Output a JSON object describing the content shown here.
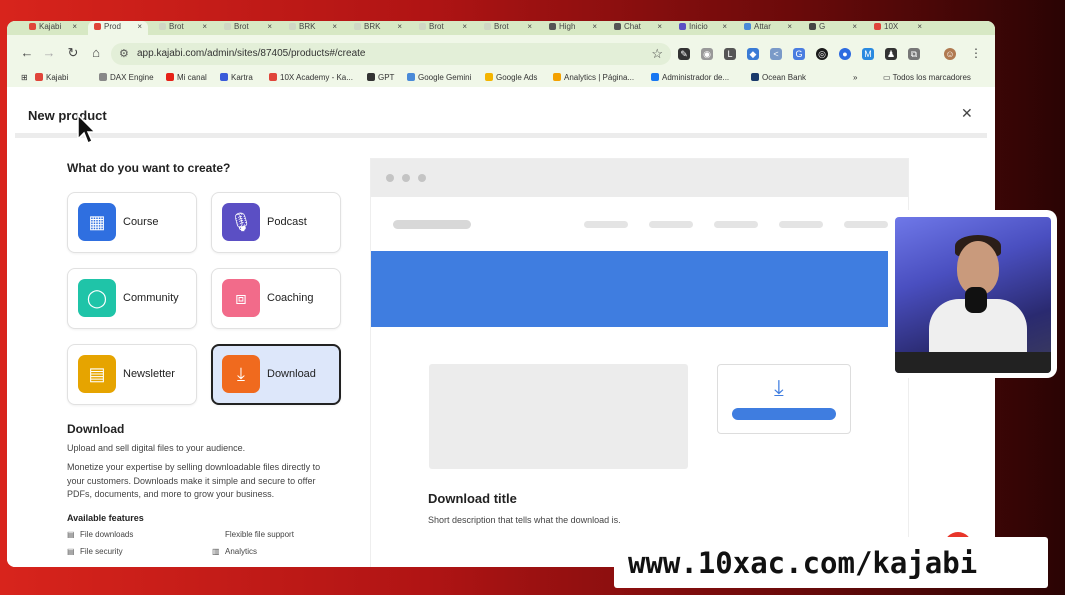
{
  "browser": {
    "tabs": [
      {
        "label": "Kajabi",
        "favicon_color": "#e0453a"
      },
      {
        "label": "Prod",
        "favicon_color": "#e0453a",
        "active": true
      },
      {
        "label": "Brot",
        "favicon_color": "#cfd7c4"
      },
      {
        "label": "Brot",
        "favicon_color": "#cfd7c4"
      },
      {
        "label": "BRK",
        "favicon_color": "#cfd7c4"
      },
      {
        "label": "BRK",
        "favicon_color": "#cfd7c4"
      },
      {
        "label": "Brot",
        "favicon_color": "#cfd7c4"
      },
      {
        "label": "Brot",
        "favicon_color": "#cfd7c4"
      },
      {
        "label": "High",
        "favicon_color": "#555555"
      },
      {
        "label": "Chat",
        "favicon_color": "#555555"
      },
      {
        "label": "Inicio",
        "favicon_color": "#5b4fc4"
      },
      {
        "label": "Attar",
        "favicon_color": "#4a8ad8"
      },
      {
        "label": "G",
        "favicon_color": "#444444"
      },
      {
        "label": "10X",
        "favicon_color": "#e0453a"
      }
    ],
    "url": "app.kajabi.com/admin/sites/87405/products#/create",
    "bookmarks": [
      {
        "label": "Kajabi",
        "color": "#e0453a"
      },
      {
        "label": "DAX Engine",
        "color": "#888888"
      },
      {
        "label": "Mi canal",
        "color": "#e62117"
      },
      {
        "label": "Kartra",
        "color": "#3a5bd9"
      },
      {
        "label": "10X Academy - Ka...",
        "color": "#e0453a"
      },
      {
        "label": "GPT",
        "color": "#333333"
      },
      {
        "label": "Google Gemini",
        "color": "#4a8ad8"
      },
      {
        "label": "Google Ads",
        "color": "#f4b400"
      },
      {
        "label": "Analytics | Página...",
        "color": "#f4a100"
      },
      {
        "label": "Administrador de...",
        "color": "#1877f2"
      },
      {
        "label": "Ocean Bank",
        "color": "#1a3a6b"
      }
    ],
    "all_bookmarks_label": "Todos los marcadores"
  },
  "page": {
    "title": "New product",
    "question": "What do you want to create?",
    "cards": [
      {
        "label": "Course",
        "icon": "course-icon",
        "color": "#2f6fe0"
      },
      {
        "label": "Podcast",
        "icon": "microphone-icon",
        "color": "#5b4fc4"
      },
      {
        "label": "Community",
        "icon": "chat-bubble-icon",
        "color": "#1fc4a8"
      },
      {
        "label": "Coaching",
        "icon": "coaching-icon",
        "color": "#f26b8a"
      },
      {
        "label": "Newsletter",
        "icon": "newsletter-icon",
        "color": "#e6a400"
      },
      {
        "label": "Download",
        "icon": "download-icon",
        "color": "#f06a1e",
        "selected": true
      }
    ],
    "selected": {
      "title": "Download",
      "short": "Upload and sell digital files to your audience.",
      "long": "Monetize your expertise by selling downloadable files directly to your customers. Downloads make it simple and secure to offer PDFs, documents, and more to grow your business.",
      "features_title": "Available features",
      "features": [
        "File downloads",
        "Flexible file support",
        "File security",
        "Analytics"
      ]
    },
    "preview": {
      "title": "Download title",
      "description": "Short description that tells what the download is."
    }
  },
  "overlay": {
    "watermark": "www.10xac.com/kajabi"
  }
}
